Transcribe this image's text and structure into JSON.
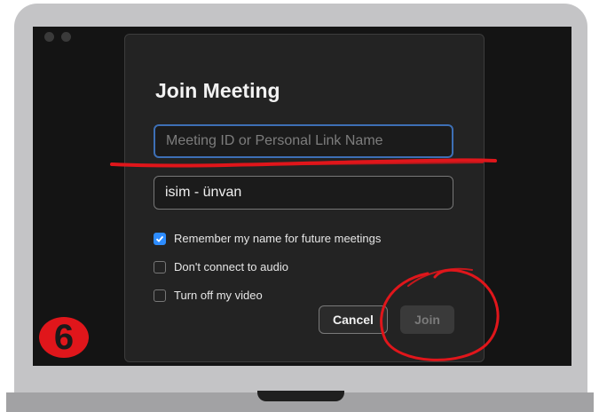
{
  "dialog": {
    "title": "Join Meeting",
    "meeting_id_placeholder": "Meeting ID or Personal Link Name",
    "name_value": "isim - ünvan",
    "options": [
      {
        "label": "Remember my name for future meetings",
        "checked": true
      },
      {
        "label": "Don't connect to audio",
        "checked": false
      },
      {
        "label": "Turn off my video",
        "checked": false
      }
    ],
    "cancel_label": "Cancel",
    "join_label": "Join"
  },
  "annotation": {
    "step_number": "6",
    "marker_color": "#e0161b"
  },
  "colors": {
    "accent": "#2d8cff",
    "dialog_bg": "#232323",
    "screen_bg": "#141414"
  }
}
